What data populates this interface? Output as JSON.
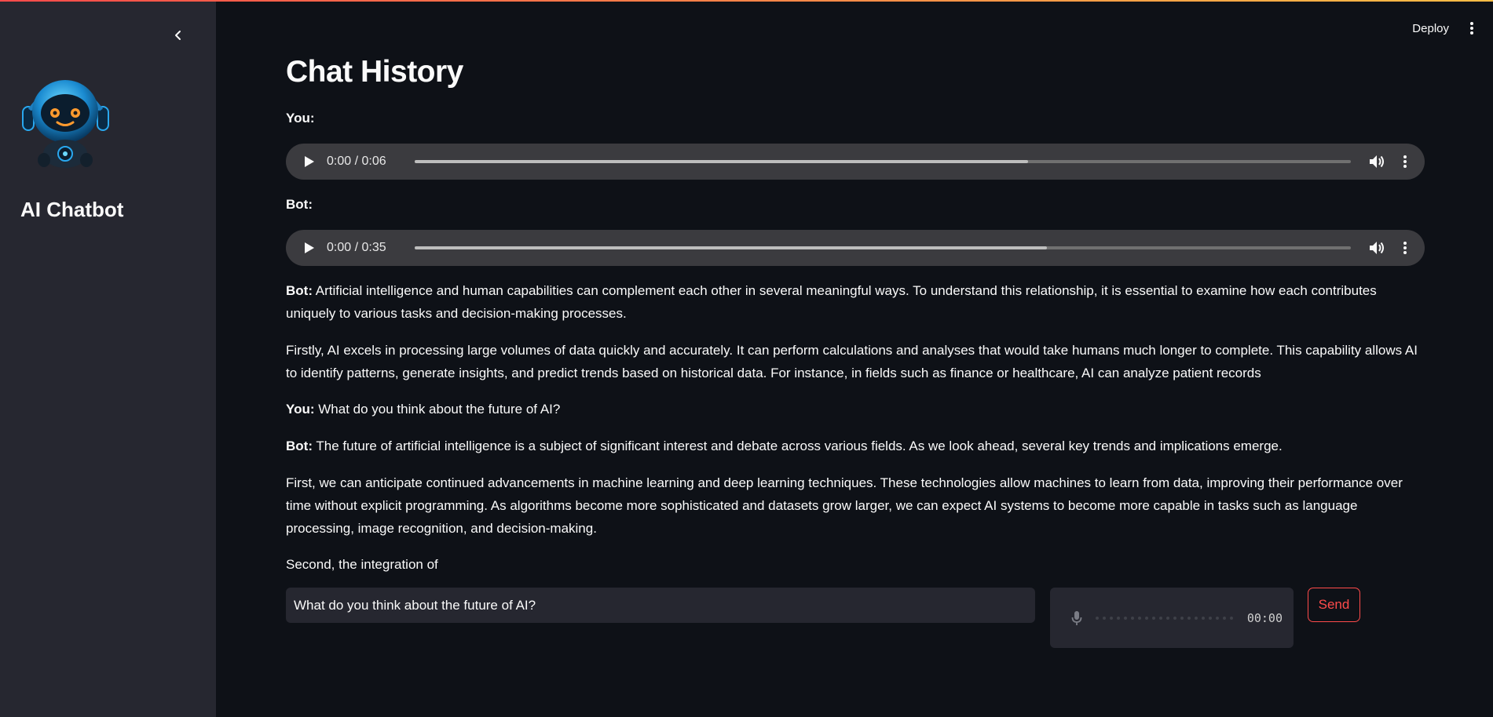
{
  "sidebar": {
    "title": "AI Chatbot",
    "collapse_icon": "chevron-left-icon",
    "avatar_icon": "robot-avatar"
  },
  "header": {
    "deploy_label": "Deploy",
    "menu_icon": "vertical-dots-icon"
  },
  "main": {
    "title": "Chat History",
    "user_audio": {
      "label": "You:",
      "time": "0:00 / 0:06",
      "buffered_fraction": 0.655
    },
    "bot_audio": {
      "label": "Bot:",
      "time": "0:00 / 0:35",
      "buffered_fraction": 0.675
    },
    "messages": [
      {
        "speaker": "Bot:",
        "text": " Artificial intelligence and human capabilities can complement each other in several meaningful ways. To understand this relationship, it is essential to examine how each contributes uniquely to various tasks and decision-making processes."
      },
      {
        "speaker": "",
        "text": "Firstly, AI excels in processing large volumes of data quickly and accurately. It can perform calculations and analyses that would take humans much longer to complete. This capability allows AI to identify patterns, generate insights, and predict trends based on historical data. For instance, in fields such as finance or healthcare, AI can analyze patient records"
      },
      {
        "speaker": "You:",
        "text": " What do you think about the future of AI?"
      },
      {
        "speaker": "Bot:",
        "text": " The future of artificial intelligence is a subject of significant interest and debate across various fields. As we look ahead, several key trends and implications emerge."
      },
      {
        "speaker": "",
        "text": "First, we can anticipate continued advancements in machine learning and deep learning techniques. These technologies allow machines to learn from data, improving their performance over time without explicit programming. As algorithms become more sophisticated and datasets grow larger, we can expect AI systems to become more capable in tasks such as language processing, image recognition, and decision-making."
      },
      {
        "speaker": "",
        "text": "Second, the integration of"
      }
    ]
  },
  "input": {
    "value": "What do you think about the future of AI?",
    "recorder_time": "00:00",
    "send_label": "Send"
  },
  "colors": {
    "background": "#0e1117",
    "sidebar": "#262730",
    "accent": "#ff4b4b"
  }
}
